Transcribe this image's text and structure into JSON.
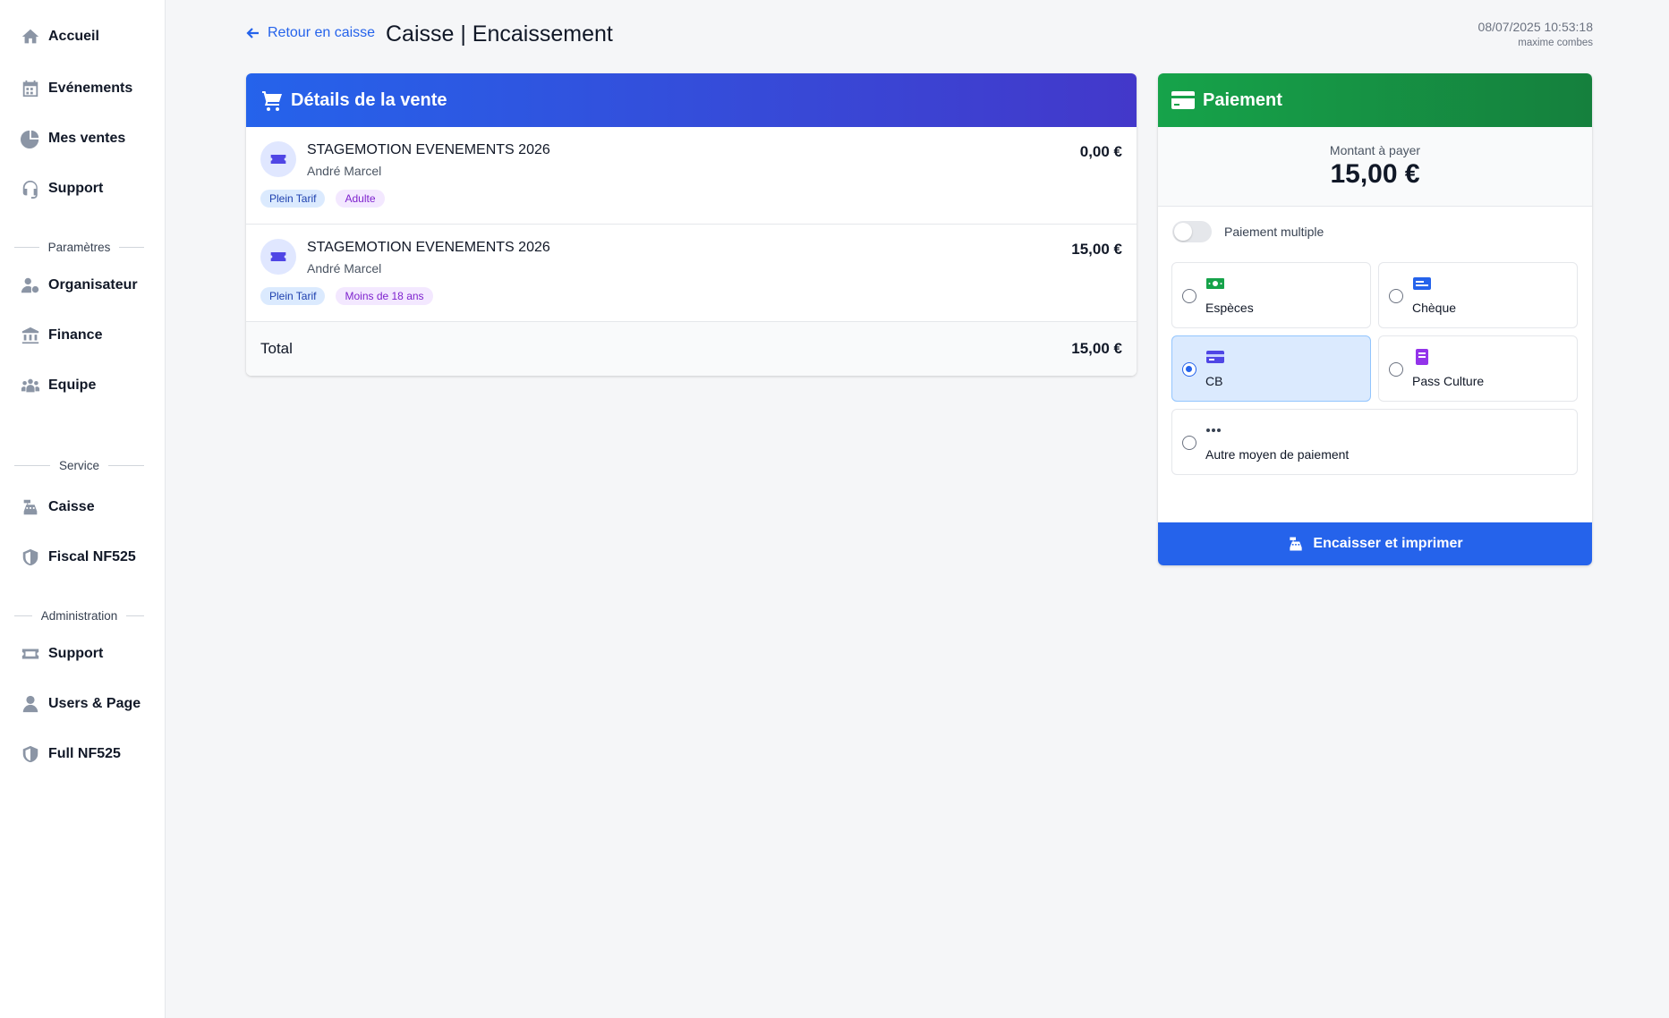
{
  "sidebar": {
    "items_main": [
      {
        "label": "Accueil",
        "icon": "home-icon"
      },
      {
        "label": "Evénements",
        "icon": "calendar-icon"
      },
      {
        "label": "Mes ventes",
        "icon": "pie-chart-icon"
      },
      {
        "label": "Support",
        "icon": "headset-icon"
      }
    ],
    "section_settings": "Paramètres",
    "items_settings": [
      {
        "label": "Organisateur",
        "icon": "user-gear-icon"
      },
      {
        "label": "Finance",
        "icon": "bank-icon"
      },
      {
        "label": "Equipe",
        "icon": "team-icon"
      }
    ],
    "section_service": "Service",
    "items_service": [
      {
        "label": "Caisse",
        "icon": "cash-register-icon"
      },
      {
        "label": "Fiscal NF525",
        "icon": "shield-icon"
      }
    ],
    "section_admin": "Administration",
    "items_admin": [
      {
        "label": "Support",
        "icon": "ticket-icon"
      },
      {
        "label": "Users & Page",
        "icon": "user-tie-icon"
      },
      {
        "label": "Full NF525",
        "icon": "shield-icon"
      }
    ]
  },
  "header": {
    "back_label": "Retour en caisse",
    "title": "Caisse | Encaissement",
    "datetime": "08/07/2025 10:53:18",
    "user": "maxime combes"
  },
  "sale": {
    "title": "Détails de la vente",
    "items": [
      {
        "event": "STAGEMOTION EVENEMENTS 2026",
        "name": "André Marcel",
        "price": "0,00 €",
        "tags": [
          "Plein Tarif",
          "Adulte"
        ]
      },
      {
        "event": "STAGEMOTION EVENEMENTS 2026",
        "name": "André Marcel",
        "price": "15,00 €",
        "tags": [
          "Plein Tarif",
          "Moins de 18 ans"
        ]
      }
    ],
    "total_label": "Total",
    "total_value": "15,00 €"
  },
  "payment": {
    "title": "Paiement",
    "amount_label": "Montant à payer",
    "amount_value": "15,00 €",
    "multi_label": "Paiement multiple",
    "multi_enabled": false,
    "selected_method": "CB",
    "methods": [
      {
        "label": "Espèces",
        "icon": "cash-bill-icon",
        "color": "#16a34a"
      },
      {
        "label": "Chèque",
        "icon": "check-card-icon",
        "color": "#2563eb"
      },
      {
        "label": "CB",
        "icon": "credit-card-icon",
        "color": "#4f46e5"
      },
      {
        "label": "Pass Culture",
        "icon": "book-icon",
        "color": "#9333ea"
      },
      {
        "label": "Autre moyen de paiement",
        "icon": "more-dots-icon",
        "color": "#374151"
      }
    ],
    "submit_label": "Encaisser et imprimer"
  }
}
